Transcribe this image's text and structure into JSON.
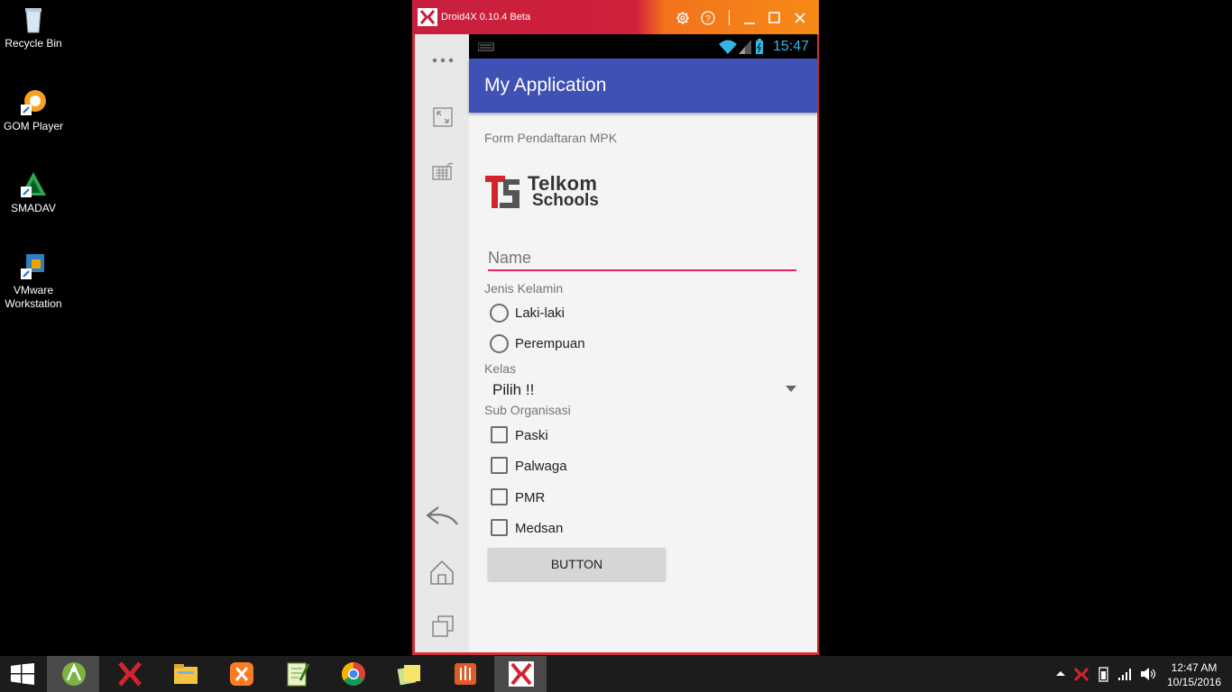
{
  "desktop": {
    "icons": [
      {
        "label": "Recycle Bin",
        "icon": "recycle-bin-icon"
      },
      {
        "label": "GOM Player",
        "icon": "gom-player-icon"
      },
      {
        "label": "SMADAV",
        "icon": "smadav-icon"
      },
      {
        "label": "VMware Workstation",
        "icon": "vmware-icon"
      }
    ]
  },
  "emulator": {
    "title": "Droid4X 0.10.4 Beta",
    "sidebar": [
      "more-icon",
      "fullscreen-icon",
      "keyboard-icon",
      "back-icon",
      "home-icon",
      "recent-apps-icon"
    ]
  },
  "android": {
    "status": {
      "time": "15:47"
    },
    "app_title": "My Application",
    "form_title": "Form Pendaftaran MPK",
    "logo": {
      "line1": "Telkom",
      "line2": "Schools"
    },
    "name_placeholder": "Name",
    "gender_label": "Jenis Kelamin",
    "gender_options": [
      "Laki-laki",
      "Perempuan"
    ],
    "class_label": "Kelas",
    "class_selected": "Pilih !!",
    "sub_label": "Sub Organisasi",
    "sub_options": [
      "Paski",
      "Palwaga",
      "PMR",
      "Medsan"
    ],
    "button_label": "BUTTON"
  },
  "taskbar": {
    "apps": [
      "android-studio-icon",
      "droid4x-icon",
      "file-explorer-icon",
      "xampp-icon",
      "notepad-plus-icon",
      "chrome-icon",
      "sticky-notes-icon",
      "app-icon",
      "droid4x-icon"
    ],
    "clock_time": "12:47 AM",
    "clock_date": "10/15/2016"
  },
  "colors": {
    "accent": "#e91e63",
    "primary": "#3f51b5",
    "titlebar_left": "#c81f3d",
    "titlebar_right": "#f78a16"
  }
}
